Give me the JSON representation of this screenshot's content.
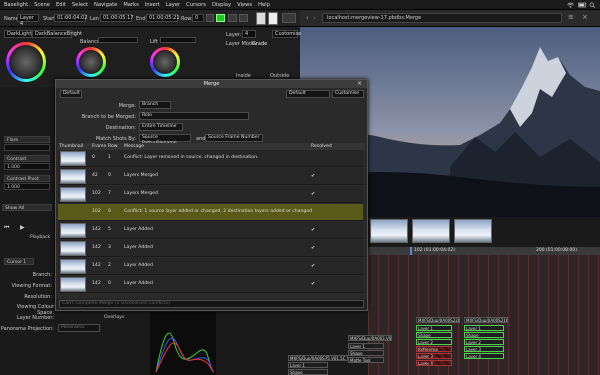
{
  "menu": {
    "items": [
      "Baselight",
      "Scene",
      "Edit",
      "Select",
      "Navigate",
      "Marks",
      "Insert",
      "Layer",
      "Cursors",
      "Display",
      "Views",
      "Help"
    ]
  },
  "toolbar": {
    "name_label": "Name:",
    "name_value": "Layer 4",
    "start_label": "Start",
    "start_value": "01:00:04:02",
    "len_label": "Len",
    "len_value": "01:00:05:17",
    "end_label": "End",
    "end_value": "01:00:05:21",
    "row_label": "Row:",
    "row_value": "0"
  },
  "browser": {
    "url": "localhost:mergeview-17.pbdbs:Merge"
  },
  "color_panel": {
    "preset1": "DarkBalanceBright",
    "balance_label": "Balance",
    "lift_label": "Lift",
    "layer_label": "Layer:",
    "layer_value": "4",
    "customise": "Customise",
    "layer_mode_label": "Layer Mode:",
    "layer_mode_value": "Grade",
    "inside_label": "Inside",
    "outside_label": "Outside",
    "preset_left": "DarkLight"
  },
  "left_strip": {
    "fields": [
      "Flare",
      "Contrast",
      "1.000",
      "Contrast Pivot",
      "1.000"
    ],
    "show_all": "Show All",
    "playback": "Playback"
  },
  "bottom_panel": {
    "cursor": "Cursor 1",
    "labels": [
      "Branch:",
      "Viewing Format:",
      "Resolution:",
      "Viewing Colour Space:",
      "Layer Number:",
      "Panorama Projection:"
    ],
    "layer_number_value": "Overlays",
    "panorama_value": "Panorama"
  },
  "merge_dialog": {
    "title": "Merge",
    "default_left": "Default",
    "default_right": "Default",
    "customise": "Customise",
    "merge_label": "Merge:",
    "merge_value": "Branch",
    "branch_label": "Branch to be Merged:",
    "branch_value": "Rolo",
    "destination_label": "Destination:",
    "destination_value": "Entire Timeline",
    "match_label": "Match Shots By:",
    "match_value_1": "Source Path+Filename",
    "and_label": "and",
    "match_value_2": "Source Frame Number",
    "columns": [
      "Thumbnail",
      "Frame",
      "Row",
      "Message",
      "Resolved"
    ],
    "rows": [
      {
        "frame": "0",
        "row": "1",
        "message": "Conflict: Layer removed in source, changed in destination.",
        "resolved": ""
      },
      {
        "frame": "42",
        "row": "0",
        "message": "Layers Merged",
        "resolved": "✔"
      },
      {
        "frame": "102",
        "row": "7",
        "message": "Layers Merged",
        "resolved": "✔"
      },
      {
        "frame": "102",
        "row": "0",
        "message": "Conflict: 1 source layer added or changed, 2 destination layers added or changed",
        "resolved": ""
      },
      {
        "frame": "142",
        "row": "5",
        "message": "Layer Added",
        "resolved": "✔"
      },
      {
        "frame": "142",
        "row": "3",
        "message": "Layer Added",
        "resolved": "✔"
      },
      {
        "frame": "142",
        "row": "2",
        "message": "Layer Added",
        "resolved": "✔"
      },
      {
        "frame": "142",
        "row": "0",
        "message": "Layer Added",
        "resolved": "✔"
      }
    ],
    "footer_text": "Can't Complete Merge (2 Unresolved Conflicts)"
  },
  "timeline": {
    "tc1": "102 (01:00:04:02)",
    "tc2": "200 (01:00:08:00)",
    "clip_titles": [
      "MXFS/Dup/0A00S75.V01.5C",
      "MXFS/Dup/0A00S228.V01.5C",
      "MXFS/Dup/0A00S216.V01.5C",
      "MXFS/Dup/0A003.V01.SC0B1.758447"
    ],
    "layer_labels": [
      "Layer 1",
      "Shape",
      "Layer 2",
      "Layer 3",
      "Layer 4",
      "Matte Tool",
      "Reference"
    ]
  },
  "colors": {
    "accent_green": "#1ec81e",
    "selected_row": "#595a18",
    "clip_green": "#4ad34a"
  }
}
